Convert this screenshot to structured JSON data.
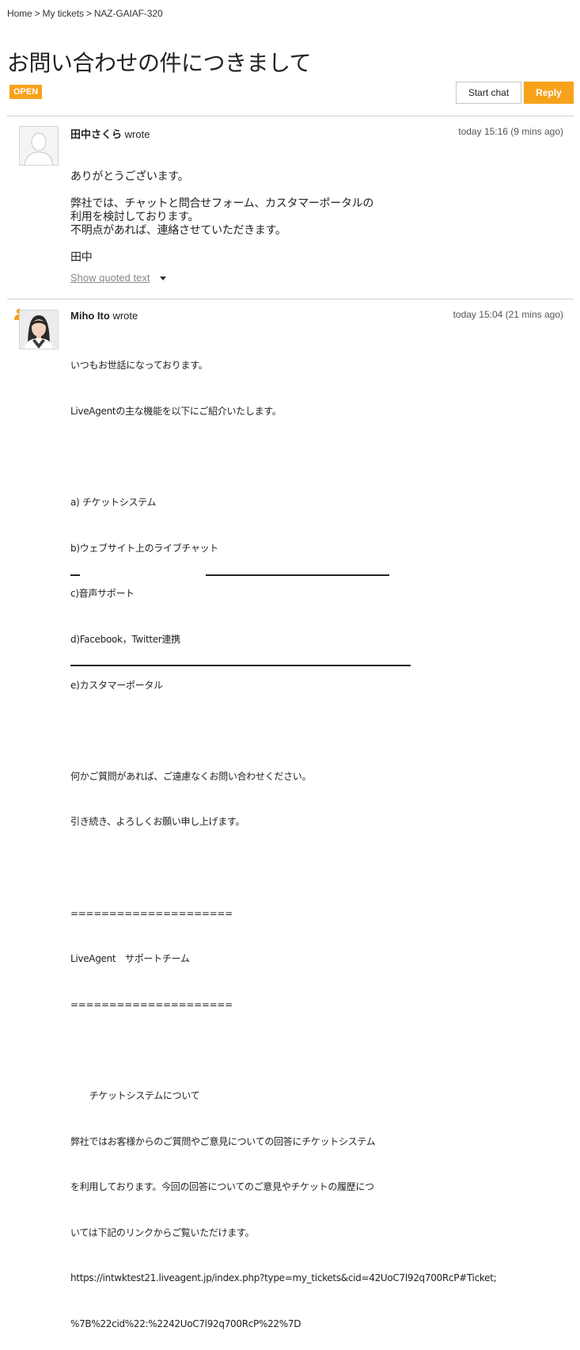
{
  "breadcrumb": {
    "home": "Home",
    "my_tickets": "My tickets",
    "ticket_id": "NAZ-GAIAF-320",
    "separator": ">"
  },
  "ticket": {
    "title": "お問い合わせの件につきまして",
    "status": "OPEN"
  },
  "actions": {
    "start_chat": "Start chat",
    "reply": "Reply"
  },
  "colors": {
    "accent": "#f7a21b"
  },
  "messages": [
    {
      "author": "田中さくら",
      "verb": "wrote",
      "time": "today 15:16 (9 mins ago)",
      "avatar": "default-user-avatar",
      "lines": [
        "ありがとうございます。",
        "",
        "弊社では、チャットと問合せフォーム、カスタマーポータルの",
        "利用を検討しております。",
        "不明点があれば、連絡させていただきます。",
        "",
        "田中"
      ],
      "show_quoted": "Show quoted text"
    },
    {
      "author": "Miho Ito",
      "verb": "wrote",
      "time": "today 15:04 (21 mins ago)",
      "avatar": "agent-photo-avatar",
      "lines": [
        "いつもお世話になっております。",
        "LiveAgentの主な機能を以下にご紹介いたします。",
        "",
        "a) チケットシステム",
        "b)ウェブサイト上のライブチャット",
        "c)音声サポート",
        "d)Facebook，Twitter連携",
        "e)カスタマーポータル",
        "",
        "何かご質問があれば、ご遠慮なくお問い合わせください。",
        "引き続き、よろしくお願い申し上げます。",
        "",
        "=====================",
        "LiveAgent　サポートチーム",
        "=====================",
        "",
        "　チケットシステムについて",
        "弊社ではお客様からのご質問やご意見についての回答にチケットシステム",
        "を利用しております。今回の回答についてのご意見やチケットの履歴につ",
        "いては下記のリンクからご覧いただけます。",
        "https://intwktest21.liveagent.jp/index.php?type=my_tickets&cid=42UoC7l92q700RcP#Ticket;",
        "%7B%22cid%22:%2242UoC7l92q700RcP%22%7D"
      ]
    }
  ]
}
